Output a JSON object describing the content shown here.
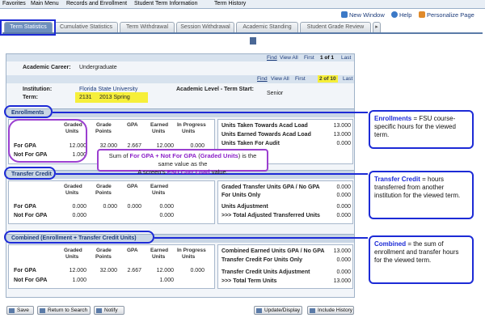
{
  "topbar": {
    "favorites": "Favorites",
    "main_menu": "Main Menu",
    "crumb1": "Records and Enrollment",
    "crumb2": "Student Term Information",
    "crumb3": "Term History"
  },
  "toolbar": {
    "new_window": "New Window",
    "help": "Help",
    "personalize": "Personalize Page"
  },
  "tabs": [
    "Term Statistics",
    "Cumulative Statistics",
    "Term Withdrawal",
    "Session Withdrawal",
    "Academic Standing",
    "Student Grade Review"
  ],
  "nav1": {
    "find": "Find",
    "view_all": "View All",
    "first": "First",
    "count": "1 of 1",
    "last": "Last"
  },
  "nav2": {
    "find": "Find",
    "view_all": "View All",
    "first": "First",
    "count": "2 of 10",
    "last": "Last"
  },
  "career": {
    "label": "Academic Career:",
    "value": "Undergraduate"
  },
  "institution": {
    "label": "Institution:",
    "value": "Florida State University"
  },
  "term": {
    "label": "Term:",
    "code": "2131",
    "desc": "2013 Spring"
  },
  "level": {
    "label": "Academic Level - Term Start:",
    "value": "Senior"
  },
  "headers": {
    "graded": "Graded",
    "units": "Units",
    "grade": "Grade",
    "points": "Points",
    "gpa": "GPA",
    "earned": "Earned",
    "inprog": "In Progress"
  },
  "enrollments": {
    "title": "Enrollments",
    "for_gpa": {
      "label": "For GPA",
      "graded": "12.000",
      "points": "32.000",
      "gpa": "2.667",
      "earned": "12.000",
      "inprog": "0.000"
    },
    "not_gpa": {
      "label": "Not For GPA",
      "graded": "1.000"
    },
    "right": [
      {
        "label": "Units Taken Towards Acad Load",
        "value": "13.000"
      },
      {
        "label": "Units Earned Towards Acad Load",
        "value": "13.000"
      },
      {
        "label": "Units Taken For Audit",
        "value": "0.000"
      }
    ]
  },
  "transfer": {
    "title": "Transfer Credit",
    "for_gpa": {
      "label": "For GPA",
      "graded": "0.000",
      "points": "0.000",
      "gpa": "0.000",
      "earned": "0.000"
    },
    "not_gpa": {
      "label": "Not For GPA",
      "graded": "0.000",
      "earned": "0.000"
    },
    "right": [
      {
        "label": "Graded Transfer Units GPA / No GPA",
        "value": "0.000"
      },
      {
        "label": "For Units Only",
        "value": "0.000"
      },
      {
        "label": "Units Adjustment",
        "value": "0.000"
      },
      {
        "label": ">>> Total Adjusted Transferred Units",
        "value": "0.000"
      }
    ]
  },
  "combined": {
    "title": "Combined (Enrollment + Transfer Credit Units)",
    "for_gpa": {
      "label": "For GPA",
      "graded": "12.000",
      "points": "32.000",
      "gpa": "2.667",
      "earned": "12.000",
      "inprog": "0.000"
    },
    "not_gpa": {
      "label": "Not For GPA",
      "graded": "1.000",
      "earned": "1.000"
    },
    "right": [
      {
        "label": "Combined Earned Units GPA / No GPA",
        "value": "13.000"
      },
      {
        "label": "Transfer Credit For Units Only",
        "value": "0.000"
      },
      {
        "label": "Transfer Credit Units Adjustment",
        "value": "0.000"
      },
      {
        "label": ">>> Total Term Units",
        "value": "13.000"
      }
    ]
  },
  "note": {
    "a": "Sum of ",
    "b": "For GPA + Not For GPA",
    "c": " (",
    "d": "Graded Units",
    "e": ") is the same value as the",
    "f": "A screen's ",
    "g": "FSU Curr Load",
    "h": " value."
  },
  "callouts": {
    "enroll": {
      "title": "Enrollments",
      "text": " = FSU course-specific hours for the viewed term."
    },
    "transfer": {
      "title": "Transfer Credit",
      "text": " = hours transferred from another institution for the viewed term."
    },
    "combined": {
      "title": "Combined",
      "text": " = the sum of enrollment and transfer hours for the viewed term."
    }
  },
  "buttons": {
    "save": "Save",
    "return": "Return to Search",
    "notify": "Notify",
    "update": "Update/Display",
    "history": "Include History"
  }
}
